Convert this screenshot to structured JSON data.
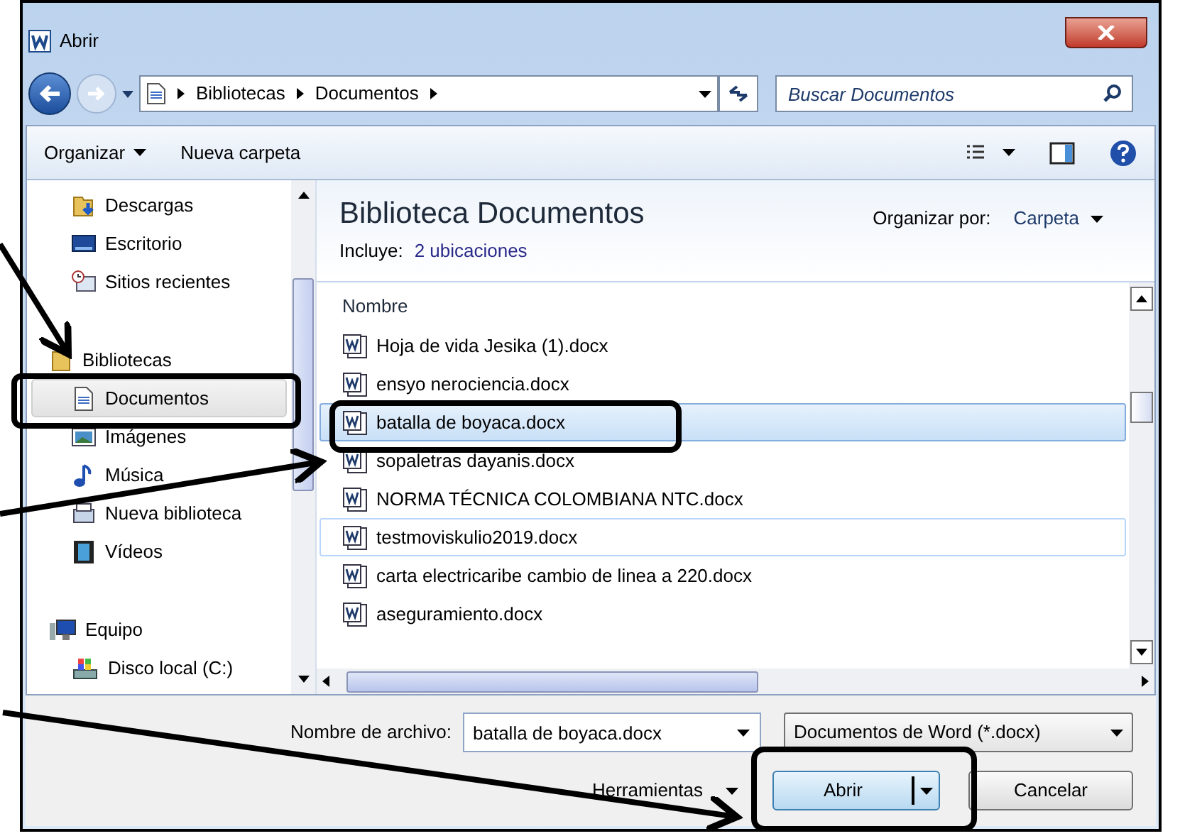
{
  "window": {
    "title": "Abrir"
  },
  "address_bar": {
    "segments": [
      "Bibliotecas",
      "Documentos"
    ]
  },
  "search": {
    "placeholder": "Buscar Documentos"
  },
  "toolbar": {
    "organize": "Organizar",
    "new_folder": "Nueva carpeta"
  },
  "nav_pane": {
    "groups": [
      {
        "items": [
          {
            "label": "Descargas",
            "kind": "downloads",
            "selected": false
          },
          {
            "label": "Escritorio",
            "kind": "desktop",
            "selected": false
          },
          {
            "label": "Sitios recientes",
            "kind": "recent",
            "selected": false
          }
        ]
      },
      {
        "label": "Bibliotecas",
        "kind": "libraries",
        "children": [
          {
            "label": "Documentos",
            "kind": "documents",
            "selected": true
          },
          {
            "label": "Imágenes",
            "kind": "pictures",
            "selected": false
          },
          {
            "label": "Música",
            "kind": "music",
            "selected": false
          },
          {
            "label": "Nueva biblioteca",
            "kind": "library",
            "selected": false
          },
          {
            "label": "Vídeos",
            "kind": "videos",
            "selected": false
          }
        ]
      },
      {
        "label": "Equipo",
        "kind": "computer",
        "children": [
          {
            "label": "Disco local (C:)",
            "kind": "drive",
            "selected": false
          }
        ]
      }
    ]
  },
  "library": {
    "title": "Biblioteca Documentos",
    "includes_label": "Incluye:",
    "includes_link": "2 ubicaciones",
    "arrange_label": "Organizar por:",
    "arrange_value": "Carpeta"
  },
  "file_list": {
    "column": "Nombre",
    "files": [
      {
        "name": "Hoja de vida Jesika (1).docx",
        "selected": false,
        "hot": false
      },
      {
        "name": "ensyo nerociencia.docx",
        "selected": false,
        "hot": false
      },
      {
        "name": "batalla de boyaca.docx",
        "selected": true,
        "hot": false
      },
      {
        "name": "sopaletras dayanis.docx",
        "selected": false,
        "hot": false
      },
      {
        "name": "NORMA TÉCNICA COLOMBIANA NTC.docx",
        "selected": false,
        "hot": false
      },
      {
        "name": "testmoviskulio2019.docx",
        "selected": false,
        "hot": true
      },
      {
        "name": "carta electricaribe cambio de linea a 220.docx",
        "selected": false,
        "hot": false
      },
      {
        "name": "aseguramiento.docx",
        "selected": false,
        "hot": false
      }
    ]
  },
  "footer": {
    "filename_label": "Nombre de archivo:",
    "filename": "batalla de boyaca.docx",
    "filter": "Documentos de Word (*.docx)",
    "tools": "Herramientas",
    "open": "Abrir",
    "cancel": "Cancelar"
  }
}
